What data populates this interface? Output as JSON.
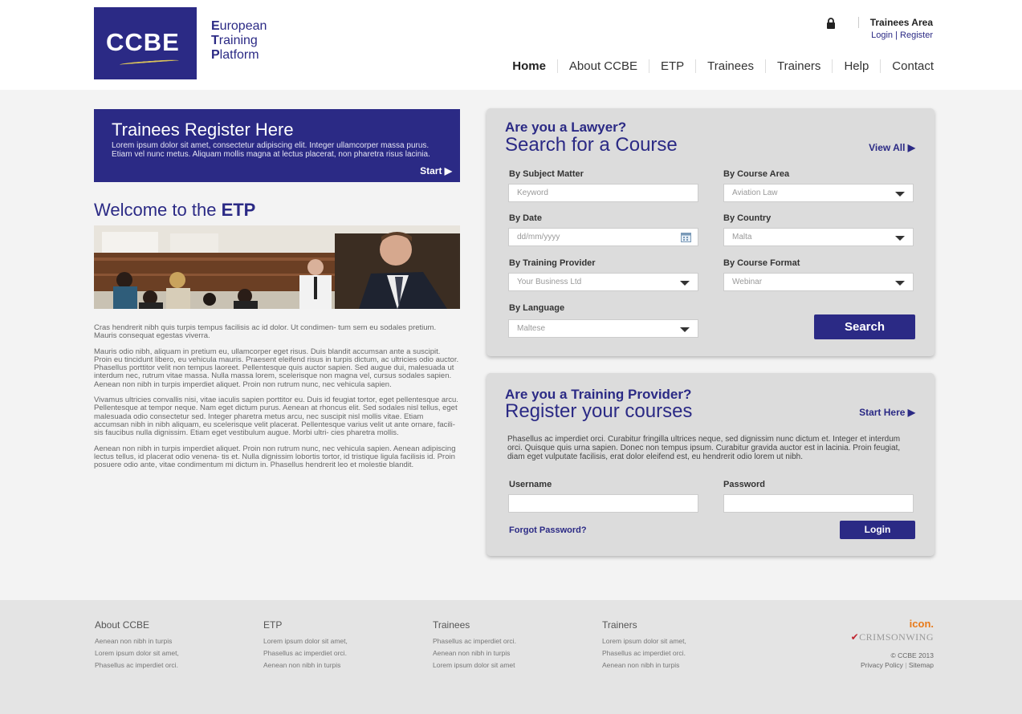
{
  "header": {
    "logo": {
      "mark": "CCBE"
    },
    "brand": {
      "line1_initial": "E",
      "line1_rest": "uropean",
      "line2_initial": "T",
      "line2_rest": "raining",
      "line3_initial": "P",
      "line3_rest": "latform"
    },
    "trainees_area": {
      "title": "Trainees Area",
      "login": "Login",
      "sep": "|",
      "register": "Register"
    },
    "nav": [
      "Home",
      "About CCBE",
      "ETP",
      "Trainees",
      "Trainers",
      "Help",
      "Contact"
    ]
  },
  "register_banner": {
    "title": "Trainees Register Here",
    "text": "Lorem ipsum dolor sit amet, consectetur adipiscing elit. Integer ullamcorper massa purus. Etiam vel nunc metus. Aliquam mollis magna at lectus placerat, non pharetra risus lacinia.",
    "start": "Start ▶"
  },
  "welcome": {
    "prefix": "Welcome to the ",
    "bold": "ETP"
  },
  "body_paragraphs": [
    "Cras hendrerit nibh quis turpis tempus facilisis ac id dolor. Ut condimen- tum sem eu sodales pretium. Mauris consequat egestas viverra.",
    "Mauris odio nibh, aliquam in pretium eu, ullamcorper eget risus. Duis blandit accumsan ante a suscipit. Proin eu tincidunt libero, eu vehicula mauris. Praesent eleifend risus in turpis dictum, ac ultricies odio auctor. Phasellus porttitor velit non tempus laoreet. Pellentesque quis auctor sapien. Sed augue dui, malesuada ut interdum nec, rutrum vitae massa. Nulla massa lorem, scelerisque non magna vel, cursus sodales sapien. Aenean non nibh in turpis imperdiet aliquet. Proin non rutrum nunc, nec vehicula sapien.",
    "Vivamus ultricies convallis nisi, vitae iaculis sapien porttitor eu. Duis id feugiat tortor, eget pellentesque arcu. Pellentesque at tempor neque. Nam eget dictum purus. Aenean at rhoncus elit. Sed sodales nisl tellus, eget malesuada odio consectetur sed. Integer pharetra metus arcu, nec suscipit nisl mollis vitae. Etiam accumsan nibh in nibh aliquam, eu scelerisque velit placerat. Pellentesque varius velit ut ante ornare, facili- sis faucibus nulla dignissim. Etiam eget vestibulum augue. Morbi ultri- cies pharetra mollis.",
    "Aenean non nibh in turpis imperdiet aliquet. Proin non rutrum nunc, nec vehicula sapien. Aenean adipiscing lectus tellus, id placerat odio venena- tis et. Nulla dignissim lobortis tortor, id tristique ligula facilisis id. Proin posuere odio ante, vitae condimentum mi dictum in. Phasellus hendrerit leo et molestie blandit."
  ],
  "search_panel": {
    "question": "Are you a Lawyer?",
    "heading": "Search for a Course",
    "view_all": "View All ▶",
    "subject": {
      "label": "By Subject Matter",
      "placeholder": "Keyword"
    },
    "area": {
      "label": "By Course Area",
      "value": "Aviation Law"
    },
    "date": {
      "label": "By Date",
      "placeholder": "dd/mm/yyyy"
    },
    "country": {
      "label": "By Country",
      "value": "Malta"
    },
    "provider": {
      "label": "By Training Provider",
      "value": "Your Business Ltd"
    },
    "format": {
      "label": "By Course Format",
      "value": "Webinar"
    },
    "language": {
      "label": "By Language",
      "value": "Maltese"
    },
    "search_button": "Search"
  },
  "provider_panel": {
    "question": "Are you a Training Provider?",
    "heading": "Register your courses",
    "start_here": "Start Here ▶",
    "text": "Phasellus ac imperdiet orci. Curabitur fringilla ultrices neque, sed dignissim nunc dictum et. Integer et interdum orci. Quisque quis urna sapien. Donec non tempus ipsum. Curabitur gravida auctor est in lacinia. Proin feugiat, diam eget vulputate facilisis, erat dolor eleifend est, eu hendrerit odio lorem ut nibh.",
    "username_label": "Username",
    "password_label": "Password",
    "forgot": "Forgot Password?",
    "login_button": "Login"
  },
  "footer": {
    "columns": [
      {
        "title": "About CCBE",
        "items": [
          "Aenean non nibh in turpis",
          "Lorem ipsum dolor sit amet,",
          "Phasellus ac imperdiet orci."
        ]
      },
      {
        "title": "ETP",
        "items": [
          "Lorem ipsum dolor sit amet,",
          "Phasellus ac imperdiet orci.",
          "Aenean non nibh in turpis"
        ]
      },
      {
        "title": "Trainees",
        "items": [
          "Phasellus ac imperdiet orci.",
          "Aenean non nibh in turpis",
          "Lorem ipsum dolor sit amet"
        ]
      },
      {
        "title": "Trainers",
        "items": [
          "Lorem ipsum dolor sit amet,",
          "Phasellus ac imperdiet orci.",
          "Aenean non nibh in turpis"
        ]
      }
    ],
    "icon_logo": "icon.",
    "crimsonwing": "CRIMSONWING",
    "copyright": "© CCBE 2013",
    "privacy": "Privacy Policy",
    "sitemap": "Sitemap"
  },
  "colors": {
    "brand": "#2b2a85",
    "panel": "#dcdcdc",
    "footer": "#e4e4e4",
    "accent_orange": "#e87a1a",
    "accent_red": "#c0242f"
  }
}
